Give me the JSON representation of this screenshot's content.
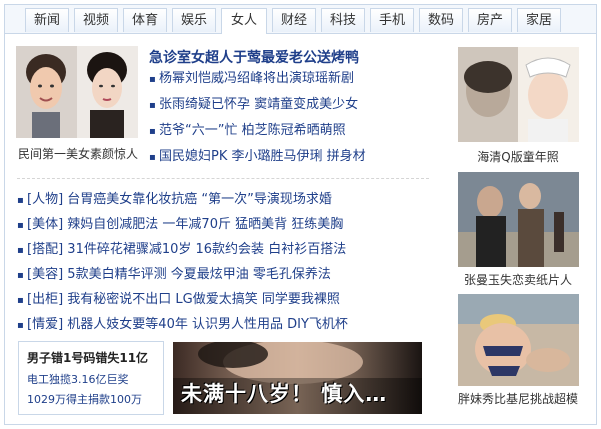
{
  "tabs": [
    "新闻",
    "视频",
    "体育",
    "娱乐",
    "女人",
    "财经",
    "科技",
    "手机",
    "数码",
    "房产",
    "家居"
  ],
  "active_tab": "女人",
  "feature": {
    "caption": "民间第一美女素颜惊人",
    "headline": "急诊室女超人于莺最爱老公送烤鸭",
    "items": [
      "杨幂刘恺威冯绍峰将出演琼瑶新剧",
      "张雨绮疑已怀孕 窦靖童变成美少女",
      "范爷“六一”忙 柏芝陈冠希晒萌照",
      "国民媳妇PK 李小璐胜马伊琍 拼身材"
    ]
  },
  "category_items": [
    {
      "cat": "[人物]",
      "text": "台胃癌美女靠化妆抗癌 “第一次”导演现场求婚"
    },
    {
      "cat": "[美体]",
      "text": "辣妈自创减肥法 一年减70斤 猛晒美背 狂练美胸"
    },
    {
      "cat": "[搭配]",
      "text": "31件碎花裙骤减10岁 16款约会装 白衬衫百搭法"
    },
    {
      "cat": "[美容]",
      "text": "5款美白精华评测 今夏最炫甲油 零毛孔保养法"
    },
    {
      "cat": "[出柜]",
      "text": "我有秘密说不出口 LG做爱太搞笑 同学要我裸照"
    },
    {
      "cat": "[情爱]",
      "text": "机器人妓女要等40年 认识男人性用品 DIY飞机杯"
    }
  ],
  "ad_left": {
    "title": "男子错1号码错失11亿",
    "line1": "电工独揽3.16亿巨奖",
    "line2": "1029万得主捐款100万"
  },
  "ad_banner": {
    "text": "未满十八岁！ 慎入…"
  },
  "sidebar": [
    {
      "caption": "海清Q版童年照"
    },
    {
      "caption": "张曼玉失恋卖纸片人"
    },
    {
      "caption": "胖妹秀比基尼挑战超模"
    }
  ]
}
